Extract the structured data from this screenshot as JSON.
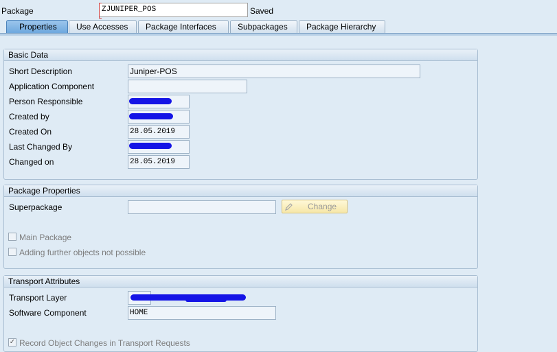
{
  "header": {
    "package_label": "Package",
    "package_value": "ZJUNIPER_POS",
    "status": "Saved"
  },
  "tabs": [
    {
      "label": "Properties",
      "active": true
    },
    {
      "label": "Use Accesses",
      "active": false
    },
    {
      "label": "Package Interfaces",
      "active": false
    },
    {
      "label": "Subpackages",
      "active": false
    },
    {
      "label": "Package Hierarchy",
      "active": false
    }
  ],
  "basic_data": {
    "title": "Basic Data",
    "short_description_label": "Short Description",
    "short_description_value": "Juniper-POS",
    "application_component_label": "Application Component",
    "application_component_value": "",
    "person_responsible_label": "Person Responsible",
    "created_by_label": "Created by",
    "created_on_label": "Created On",
    "created_on_value": "28.05.2019",
    "last_changed_by_label": "Last Changed By",
    "changed_on_label": "Changed on",
    "changed_on_value": "28.05.2019"
  },
  "package_properties": {
    "title": "Package Properties",
    "superpackage_label": "Superpackage",
    "superpackage_value": "",
    "change_button": "Change",
    "main_package_label": "Main Package",
    "main_package_checked": false,
    "adding_objects_label": "Adding further objects not possible",
    "adding_objects_checked": false
  },
  "transport_attributes": {
    "title": "Transport Attributes",
    "transport_layer_label": "Transport Layer",
    "software_component_label": "Software Component",
    "software_component_value": "HOME",
    "record_changes_label": "Record Object Changes in Transport Requests",
    "record_changes_checked": true
  },
  "colors": {
    "background": "#dfebf5",
    "active_tab": "#6ea8de",
    "redaction": "#1414e6",
    "change_button": "#f6e7a8"
  }
}
